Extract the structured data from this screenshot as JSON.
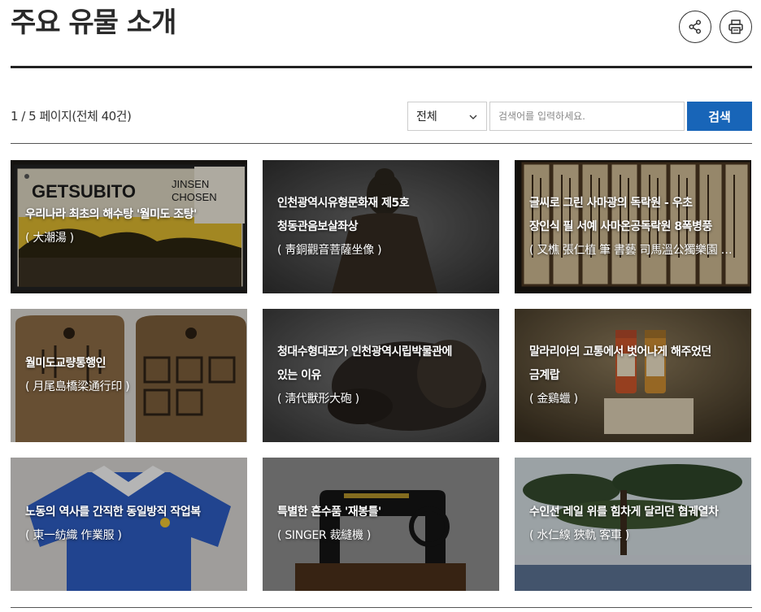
{
  "page": {
    "title": "주요 유물 소개",
    "page_info": "1 / 5 페이지(전체 40건)"
  },
  "actions": {
    "share_icon": "share-icon",
    "print_icon": "print-icon"
  },
  "search": {
    "category_selected": "전체",
    "placeholder": "검색어를 입력하세요.",
    "button_label": "검색",
    "button_color": "#1865b8"
  },
  "items": [
    {
      "line1": "우리나라 최초의 해수탕 '월미도 조탕'",
      "line2": "",
      "sub": "大潮湯"
    },
    {
      "line1": "인천광역시유형문화재 제5호",
      "line2": "청동관음보살좌상",
      "sub": "靑銅觀音菩薩坐像"
    },
    {
      "line1": "글씨로 그린 사마광의 독락원 - 우초",
      "line2": "장인식 필 서예 사마온공독락원 8폭병풍",
      "sub": "又樵 張仁植 筆 書藝 司馬溫公獨樂園 八幅屛風"
    },
    {
      "line1": "월미도교량통행인",
      "line2": "",
      "sub": "月尾島橋梁通行印"
    },
    {
      "line1": "청대수형대포가 인천광역시립박물관에",
      "line2": "있는 이유",
      "sub": "淸代獸形大砲"
    },
    {
      "line1": "말라리아의 고통에서 벗어나게 해주었던",
      "line2": "금계랍",
      "sub": "金鷄蠟"
    },
    {
      "line1": "노동의 역사를 간직한 동일방직 작업복",
      "line2": "",
      "sub": "東一紡織 作業服"
    },
    {
      "line1": "특별한 혼수품 '재봉틀'",
      "line2": "",
      "sub": "SINGER 裁縫機"
    },
    {
      "line1": "수인선 레일 위를 힘차게 달리던 협궤열차",
      "line2": "",
      "sub": "水仁線 狹軌 客車"
    }
  ]
}
